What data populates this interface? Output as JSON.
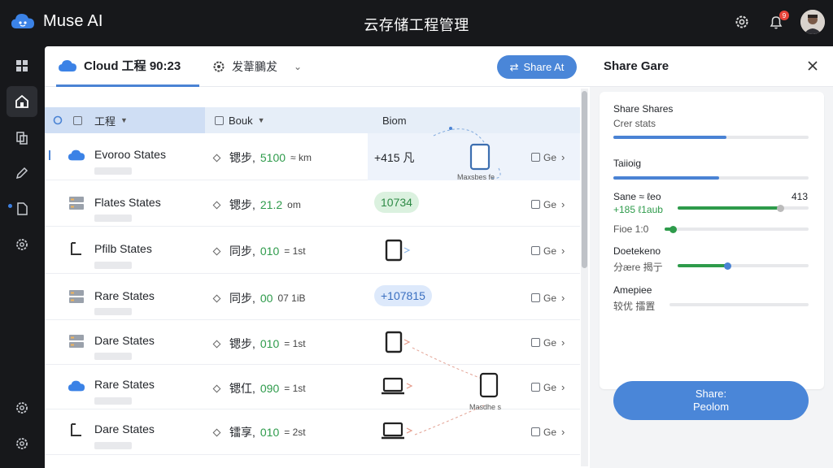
{
  "app": {
    "brand": "Muse AI",
    "title": "云存储工程管理",
    "notification_count": "9"
  },
  "tabs": [
    {
      "label": "Cloud 工程 90:23"
    },
    {
      "label": "发葦鵩犮"
    }
  ],
  "share_button": "Share At",
  "table": {
    "headers": [
      "工程",
      "Bouk",
      "Biom"
    ],
    "rows": [
      {
        "name": "Evoroo States",
        "sync_prefix": "锶步,",
        "sync_value": "5100",
        "sync_unit": "≈ km",
        "biom": "+415 凡",
        "biom_type": "text",
        "action": "Ge"
      },
      {
        "name": "Flates States",
        "sync_prefix": "锶步,",
        "sync_value": "21.2",
        "sync_unit": "om",
        "biom": "10734",
        "biom_type": "pill-green",
        "action": "Ge"
      },
      {
        "name": "Pfilb States",
        "sync_prefix": "同步,",
        "sync_value": "010",
        "sync_unit": "= 1st",
        "biom": "",
        "biom_type": "device",
        "action": "Ge"
      },
      {
        "name": "Rare States",
        "sync_prefix": "同步,",
        "sync_value": "00",
        "sync_unit": "07 1iB",
        "biom": "+107815",
        "biom_type": "pill-blue",
        "action": "Ge"
      },
      {
        "name": "Dare States",
        "sync_prefix": "锶步,",
        "sync_value": "010",
        "sync_unit": "= 1st",
        "biom": "",
        "biom_type": "device",
        "action": "Ge"
      },
      {
        "name": "Rare States",
        "sync_prefix": "锶仜,",
        "sync_value": "090",
        "sync_unit": "= 1st",
        "biom": "",
        "biom_type": "laptop",
        "action": "Ge"
      },
      {
        "name": "Dare States",
        "sync_prefix": "镭享,",
        "sync_value": "010",
        "sync_unit": "= 2st",
        "biom": "",
        "biom_type": "laptop",
        "action": "Ge"
      }
    ],
    "node_labels": [
      "Maxsbes fe",
      "Masdhe s"
    ]
  },
  "side": {
    "title": "Share Gare",
    "sections": [
      {
        "label": "Share Shares",
        "sub": "Crer stats",
        "progress": 0.58
      },
      {
        "label": "Taiioig",
        "progress": 0.54
      },
      {
        "label": "Sane ≈ ℓeo",
        "value": "413",
        "sub": "+185 ℓ1aub",
        "sub2": "Fioe 1:0",
        "progress": 0.78
      },
      {
        "label": "Doetekeno",
        "sub": "分ære 揭亍",
        "progress": 0.38
      },
      {
        "label": "Amepiee",
        "sub": "较优 擂置"
      }
    ],
    "primary_button_line1": "Share:",
    "primary_button_line2": "Peolom"
  }
}
